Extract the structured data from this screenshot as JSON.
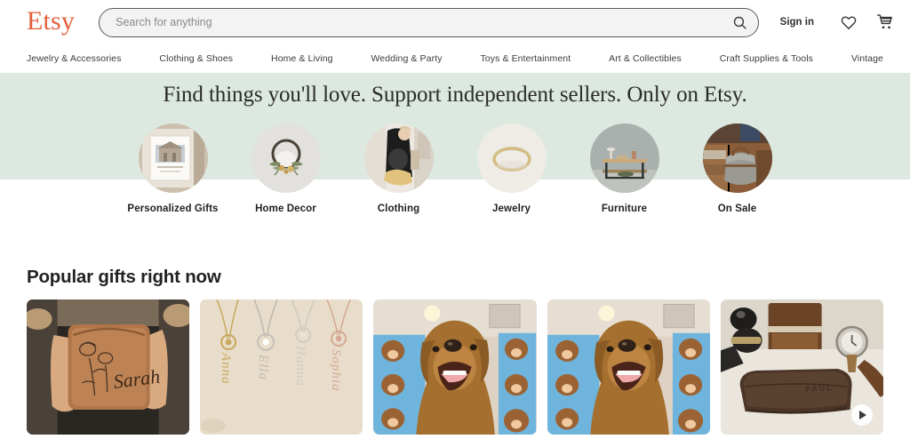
{
  "brand": {
    "name": "Etsy",
    "logo_color": "#E2603A"
  },
  "header": {
    "search": {
      "placeholder": "Search for anything",
      "value": "",
      "icon": "search-icon"
    },
    "sign_in_label": "Sign in",
    "favorites_icon": "heart-icon",
    "cart_icon": "shopping-cart-icon"
  },
  "nav": {
    "items": [
      {
        "label": "Jewelry & Accessories"
      },
      {
        "label": "Clothing & Shoes"
      },
      {
        "label": "Home & Living"
      },
      {
        "label": "Wedding & Party"
      },
      {
        "label": "Toys & Entertainment"
      },
      {
        "label": "Art & Collectibles"
      },
      {
        "label": "Craft Supplies & Tools"
      },
      {
        "label": "Vintage"
      }
    ]
  },
  "hero": {
    "tagline": "Find things you'll love. Support independent sellers. Only on Etsy.",
    "band_color": "#DCE8E0",
    "categories": [
      {
        "label": "Personalized Gifts",
        "image": "framed-house-art-print"
      },
      {
        "label": "Home Decor",
        "image": "dried-flower-wreath"
      },
      {
        "label": "Clothing",
        "image": "woman-in-black-dress"
      },
      {
        "label": "Jewelry",
        "image": "gold-bangle-bracelet"
      },
      {
        "label": "Furniture",
        "image": "wooden-console-table"
      },
      {
        "label": "On Sale",
        "image": "gray-canvas-duffel-bag"
      }
    ]
  },
  "popular": {
    "title": "Popular gifts right now",
    "cards": [
      {
        "name": "personalized-leather-jewelry-case",
        "engraved_name": "Sarah",
        "has_video": false
      },
      {
        "name": "birth-flower-name-necklaces",
        "engraved_name": "",
        "has_video": false
      },
      {
        "name": "custom-pet-face-blanket-dog",
        "engraved_name": "",
        "has_video": false
      },
      {
        "name": "custom-pet-face-blanket-dog",
        "engraved_name": "",
        "has_video": false
      },
      {
        "name": "personalized-leather-wallet",
        "engraved_name": "PAUL",
        "has_video": true
      }
    ],
    "play_icon": "play-icon"
  }
}
